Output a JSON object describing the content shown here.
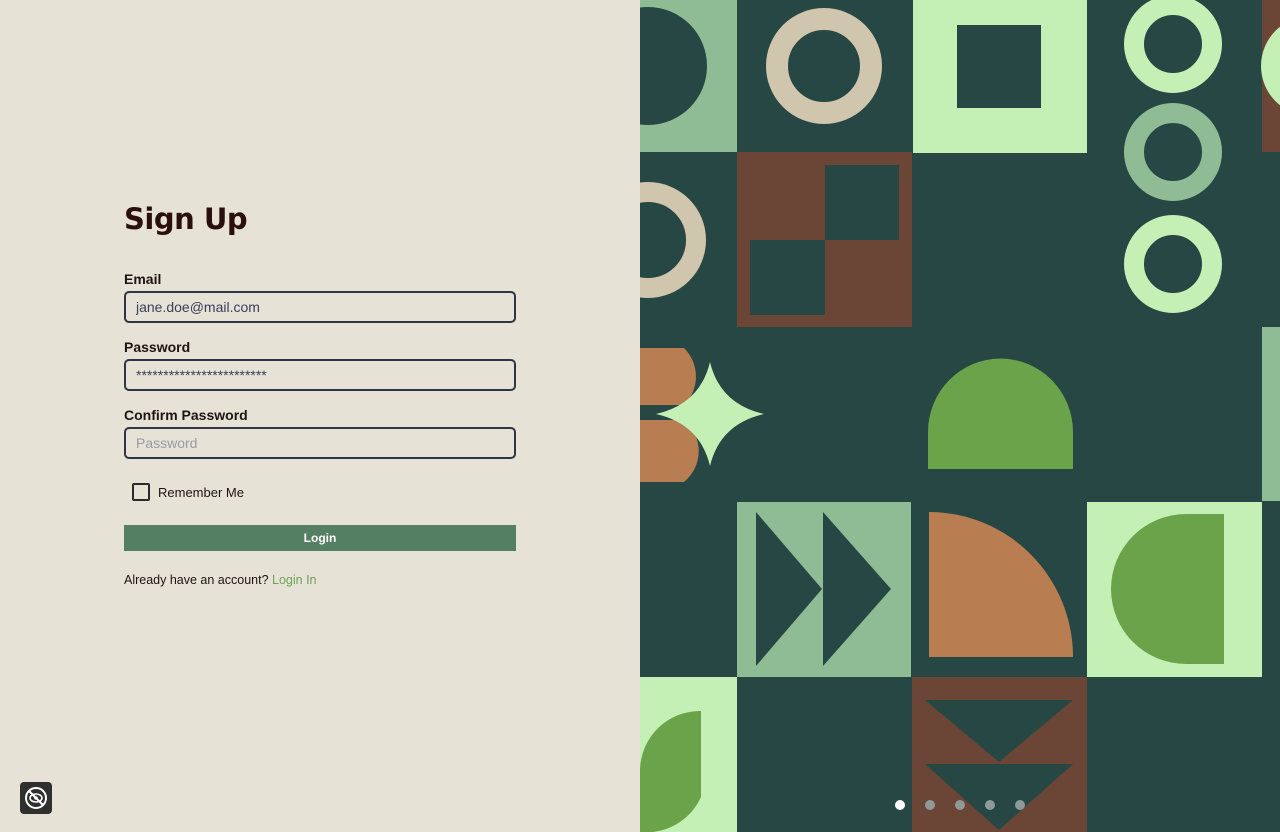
{
  "form": {
    "title": "Sign Up",
    "email": {
      "label": "Email",
      "value": "jane.doe@mail.com",
      "placeholder": ""
    },
    "password": {
      "label": "Password",
      "value": "************************",
      "placeholder": ""
    },
    "confirm_password": {
      "label": "Confirm Password",
      "value": "",
      "placeholder": "Password"
    },
    "remember_me": {
      "label": "Remember Me",
      "checked": false
    },
    "submit_label": "Login",
    "account_prompt": "Already have an account?",
    "login_link": "Login In"
  },
  "carousel": {
    "slide_count": 5,
    "active_index": 0
  },
  "icons": {
    "accessibility": "eye-off-icon"
  },
  "colors": {
    "page_background": "#E6E2D6",
    "panel_background": "#264744",
    "title": "#2B0F0C",
    "button": "#557F63",
    "link": "#6EA25A",
    "input_border": "#2F3448",
    "light_green": "#C5F0B5",
    "sage": "#8FBC94",
    "brown": "#6B4535",
    "beige": "#D0C6AE",
    "orange": "#B87E51",
    "grass": "#6BA34A"
  }
}
